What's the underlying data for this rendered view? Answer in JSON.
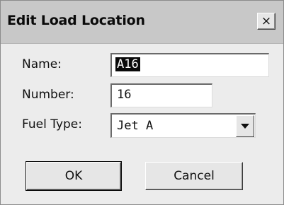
{
  "dialog": {
    "title": "Edit Load Location",
    "close_symbol": "×"
  },
  "form": {
    "name_label": "Name:",
    "name_value": "A16",
    "number_label": "Number:",
    "number_value": "16",
    "fuel_type_label": "Fuel Type:",
    "fuel_type_value": "Jet A"
  },
  "buttons": {
    "ok_label": "OK",
    "cancel_label": "Cancel"
  },
  "icons": {
    "close": "close-icon",
    "dropdown": "chevron-down-icon"
  }
}
